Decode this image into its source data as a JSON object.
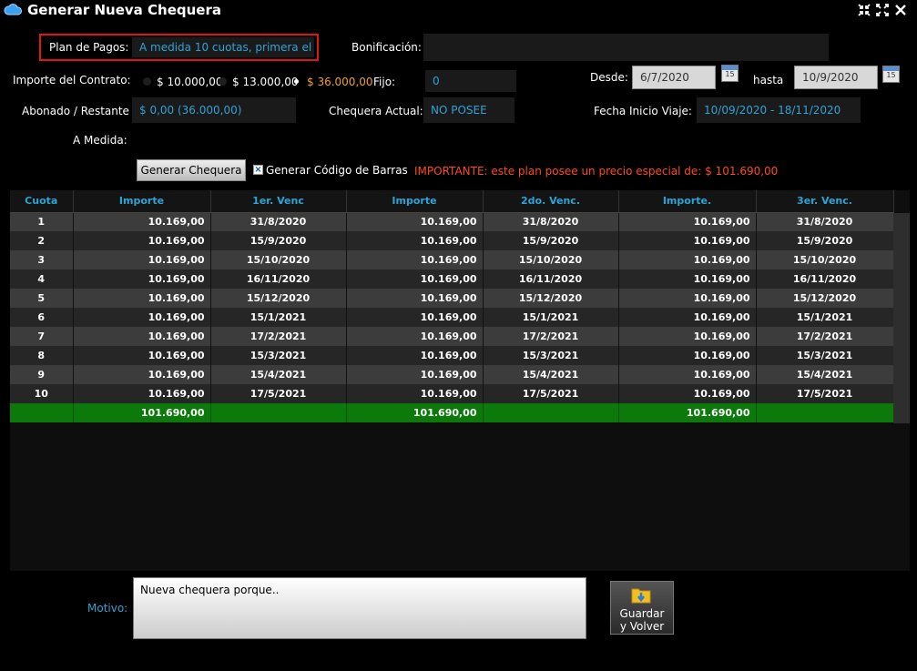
{
  "window": {
    "title": "Generar Nueva Chequera"
  },
  "form": {
    "plan_label": "Plan de Pagos:",
    "plan_value": "A medida 10 cuotas, primera el",
    "bonificacion_label": "Bonificación:",
    "bonificacion_value": "",
    "importe_label": "Importe del Contrato:",
    "importe_options": [
      "$ 10.000,00",
      "$ 13.000,00",
      "$ 36.000,00"
    ],
    "importe_selected": "$ 36.000,00",
    "fijo_label": "Fijo:",
    "fijo_value": "0",
    "desde_label": "Desde:",
    "desde_value": "6/7/2020",
    "hasta_label": "hasta",
    "hasta_value": "10/9/2020",
    "abonado_label": "Abonado / Restante",
    "abonado_value": "$ 0,00 (36.000,00)",
    "chequera_label": "Chequera Actual:",
    "chequera_value": "NO POSEE",
    "fecha_label": "Fecha Inicio Viaje:",
    "fecha_value": "10/09/2020 - 18/11/2020",
    "amedida_label": "A Medida:",
    "calendar_day": "15"
  },
  "actions": {
    "generar_label": "Generar Chequera",
    "barcode_label": "Generar Código de Barras",
    "barcode_checked": true,
    "warning": "IMPORTANTE: este plan posee un precio especial de: $ 101.690,00"
  },
  "table": {
    "headers": [
      "Cuota",
      "Importe",
      "1er. Venc",
      "Importe",
      "2do. Venc.",
      "Importe.",
      "3er. Venc."
    ],
    "rows": [
      [
        "1",
        "10.169,00",
        "31/8/2020",
        "10.169,00",
        "31/8/2020",
        "10.169,00",
        "31/8/2020"
      ],
      [
        "2",
        "10.169,00",
        "15/9/2020",
        "10.169,00",
        "15/9/2020",
        "10.169,00",
        "15/9/2020"
      ],
      [
        "3",
        "10.169,00",
        "15/10/2020",
        "10.169,00",
        "15/10/2020",
        "10.169,00",
        "15/10/2020"
      ],
      [
        "4",
        "10.169,00",
        "16/11/2020",
        "10.169,00",
        "16/11/2020",
        "10.169,00",
        "16/11/2020"
      ],
      [
        "5",
        "10.169,00",
        "15/12/2020",
        "10.169,00",
        "15/12/2020",
        "10.169,00",
        "15/12/2020"
      ],
      [
        "6",
        "10.169,00",
        "15/1/2021",
        "10.169,00",
        "15/1/2021",
        "10.169,00",
        "15/1/2021"
      ],
      [
        "7",
        "10.169,00",
        "17/2/2021",
        "10.169,00",
        "17/2/2021",
        "10.169,00",
        "17/2/2021"
      ],
      [
        "8",
        "10.169,00",
        "15/3/2021",
        "10.169,00",
        "15/3/2021",
        "10.169,00",
        "15/3/2021"
      ],
      [
        "9",
        "10.169,00",
        "15/4/2021",
        "10.169,00",
        "15/4/2021",
        "10.169,00",
        "15/4/2021"
      ],
      [
        "10",
        "10.169,00",
        "17/5/2021",
        "10.169,00",
        "17/5/2021",
        "10.169,00",
        "17/5/2021"
      ]
    ],
    "total": [
      "",
      "101.690,00",
      "",
      "101.690,00",
      "",
      "101.690,00",
      ""
    ]
  },
  "footer": {
    "motivo_label": "Motivo:",
    "motivo_value": "Nueva chequera porque..",
    "save_label_1": "Guardar",
    "save_label_2": "y Volver"
  },
  "colors": {
    "accent": "#2ea3d6",
    "warning": "#ff4a1a",
    "total_row": "#0b7a0b",
    "selected_radio": "#f0a020"
  }
}
